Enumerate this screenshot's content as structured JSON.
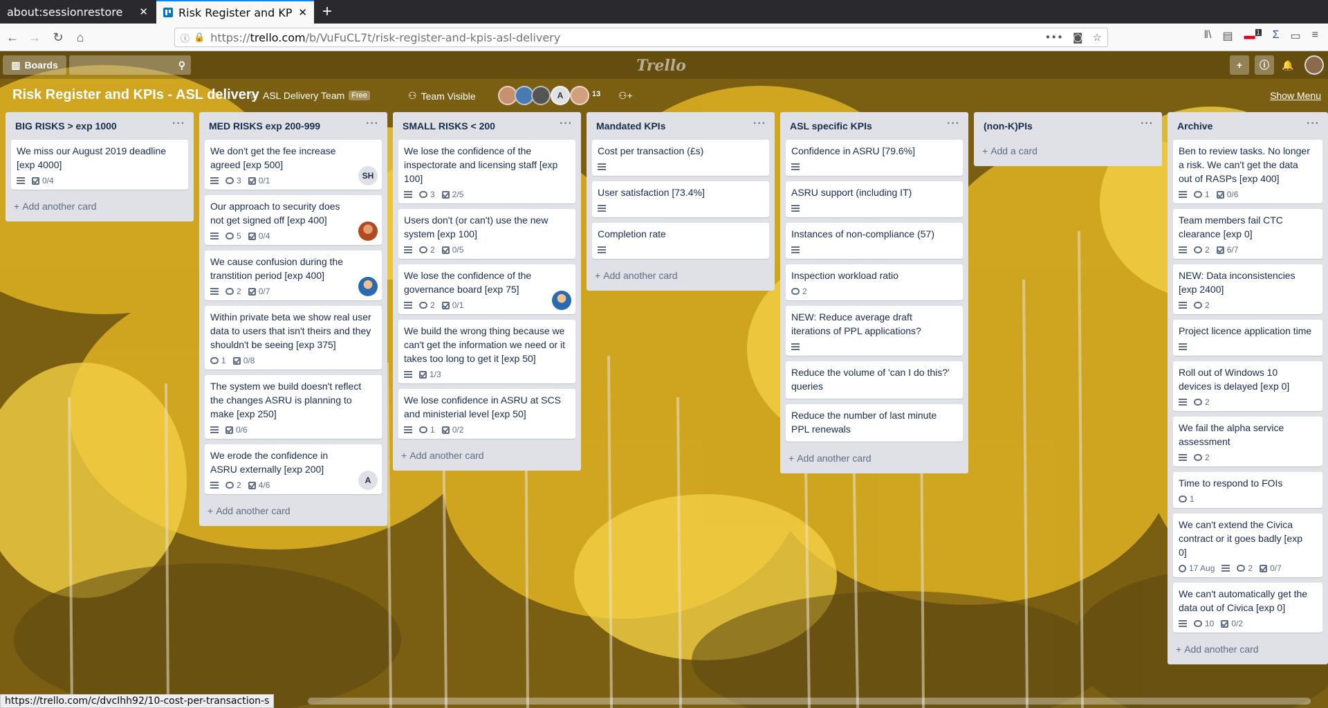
{
  "browser": {
    "tabs": [
      {
        "label": "about:sessionrestore"
      },
      {
        "label": "Risk Register and KP"
      }
    ],
    "url_prefix": "https://",
    "url_domain": "trello.com",
    "url_path": "/b/VuFuCL7t/risk-register-and-kpis-asl-delivery",
    "status_url": "https://trello.com/c/dvcIhh92/10-cost-per-transaction-s",
    "notification_count": "1"
  },
  "header": {
    "boards_label": "Boards",
    "logo": "Trello"
  },
  "board": {
    "title": "Risk Register and KPIs - ASL delivery",
    "team": "ASL Delivery Team",
    "free_badge": "Free",
    "visibility": "Team Visible",
    "member_initial": "A",
    "member_count": "13",
    "show_menu": "Show Menu"
  },
  "lists": [
    {
      "title": "BIG RISKS > exp 1000",
      "add_label": "Add another card",
      "cards": [
        {
          "text": "We miss our August 2019 deadline [exp 4000]",
          "desc": true,
          "checklist": "0/4"
        }
      ]
    },
    {
      "title": "MED RISKS exp 200-999",
      "add_label": "Add another card",
      "cards": [
        {
          "text": "We don't get the fee increase agreed [exp 500]",
          "desc": true,
          "comments": "3",
          "checklist": "0/1",
          "member": "SH"
        },
        {
          "text": "Our approach to security does not get signed off [exp 400]",
          "desc": true,
          "comments": "5",
          "checklist": "0/4",
          "member_photo": "photo1"
        },
        {
          "text": "We cause confusion during the transtition period [exp 400]",
          "desc": true,
          "comments": "2",
          "checklist": "0/7",
          "member_photo": "photo2"
        },
        {
          "text": "Within private beta we show real user data to users that isn't theirs and they shouldn't be seeing [exp 375]",
          "comments": "1",
          "checklist": "0/8"
        },
        {
          "text": "The system we build doesn't reflect the changes ASRU is planning to make [exp 250]",
          "desc": true,
          "checklist": "0/6"
        },
        {
          "text": "We erode the confidence in ASRU externally [exp 200]",
          "desc": true,
          "comments": "2",
          "checklist": "4/6",
          "member": "A"
        }
      ]
    },
    {
      "title": "SMALL RISKS < 200",
      "add_label": "Add another card",
      "cards": [
        {
          "text": "We lose the confidence of the inspectorate and licensing staff [exp 100]",
          "desc": true,
          "comments": "3",
          "checklist": "2/5"
        },
        {
          "text": "Users don't (or can't) use the new system [exp 100]",
          "desc": true,
          "comments": "2",
          "checklist": "0/5"
        },
        {
          "text": "We lose the confidence of the governance board [exp 75]",
          "desc": true,
          "comments": "2",
          "checklist": "0/1",
          "member_photo": "photo2"
        },
        {
          "text": "We build the wrong thing because we can't get the information we need or it takes too long to get it [exp 50]",
          "desc": true,
          "checklist": "1/3"
        },
        {
          "text": "We lose confidence in ASRU at SCS and ministerial level [exp 50]",
          "desc": true,
          "comments": "1",
          "checklist": "0/2"
        }
      ]
    },
    {
      "title": "Mandated KPIs",
      "add_label": "Add another card",
      "cards": [
        {
          "text": "Cost per transaction (£s)",
          "desc": true
        },
        {
          "text": "User satisfaction [73.4%]",
          "desc": true
        },
        {
          "text": "Completion rate",
          "desc": true
        }
      ]
    },
    {
      "title": "ASL specific KPIs",
      "add_label": "Add another card",
      "cards": [
        {
          "text": "Confidence in ASRU [79.6%]",
          "desc": true
        },
        {
          "text": "ASRU support (including IT)",
          "desc": true
        },
        {
          "text": "Instances of non-compliance (57)",
          "desc": true
        },
        {
          "text": "Inspection workload ratio",
          "comments": "2"
        },
        {
          "text": "NEW: Reduce average draft iterations of PPL applications?",
          "desc": true
        },
        {
          "text": "Reduce the volume of 'can I do this?' queries"
        },
        {
          "text": "Reduce the number of last minute PPL renewals"
        }
      ]
    },
    {
      "title": "(non-K)PIs",
      "add_label": "Add a card",
      "cards": []
    },
    {
      "title": "Archive",
      "add_label": "Add another card",
      "cards": [
        {
          "text": "Ben to review tasks. No longer a risk. We can't get the data out of RASPs [exp 400]",
          "desc": true,
          "comments": "1",
          "checklist": "0/6"
        },
        {
          "text": "Team members fail CTC clearance [exp 0]",
          "desc": true,
          "comments": "2",
          "checklist": "6/7"
        },
        {
          "text": "NEW: Data inconsistencies [exp 2400]",
          "desc": true,
          "comments": "2"
        },
        {
          "text": "Project licence application time",
          "desc": true
        },
        {
          "text": "Roll out of Windows 10 devices is delayed [exp 0]",
          "desc": true,
          "comments": "2"
        },
        {
          "text": "We fail the alpha service assessment",
          "desc": true,
          "comments": "2"
        },
        {
          "text": "Time to respond to FOIs",
          "comments": "1"
        },
        {
          "text": "We can't extend the Civica contract or it goes badly [exp 0]",
          "due": "17 Aug",
          "desc": true,
          "comments": "2",
          "checklist": "0/7"
        },
        {
          "text": "We can't automatically get the data out of Civica [exp 0]",
          "desc": true,
          "comments": "10",
          "checklist": "0/2"
        }
      ]
    }
  ],
  "icons": [
    "back-icon",
    "forward-icon",
    "reload-icon",
    "home-icon",
    "lock-icon",
    "bookmark-star-icon",
    "library-icon",
    "sidebar-icon",
    "hamburger-menu-icon",
    "boards-icon",
    "search-icon",
    "plus-icon",
    "info-icon",
    "bell-icon",
    "star-icon",
    "team-icon",
    "visibility-icon",
    "add-member-icon"
  ]
}
